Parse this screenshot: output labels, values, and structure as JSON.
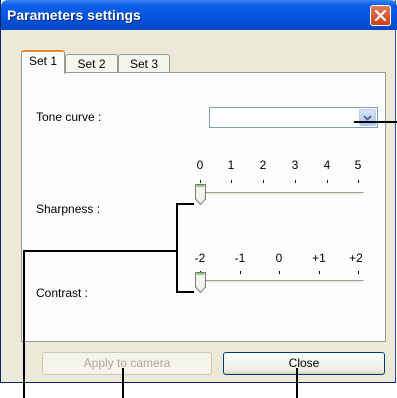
{
  "window": {
    "title": "Parameters settings"
  },
  "tabs": [
    {
      "label": "Set 1",
      "active": true
    },
    {
      "label": "Set 2",
      "active": false
    },
    {
      "label": "Set 3",
      "active": false
    }
  ],
  "tone_curve": {
    "label": "Tone curve :",
    "value": ""
  },
  "sharpness": {
    "label": "Sharpness :",
    "ticks": [
      "0",
      "1",
      "2",
      "3",
      "4",
      "5"
    ],
    "value": "0"
  },
  "contrast": {
    "label": "Contrast :",
    "ticks": [
      "-2",
      "-1",
      "0",
      "+1",
      "+2"
    ],
    "value": "-2"
  },
  "buttons": {
    "apply": "Apply to camera",
    "apply_enabled": false,
    "close": "Close"
  },
  "icons": {
    "close": "close-icon",
    "dropdown": "chevron-down-icon"
  }
}
